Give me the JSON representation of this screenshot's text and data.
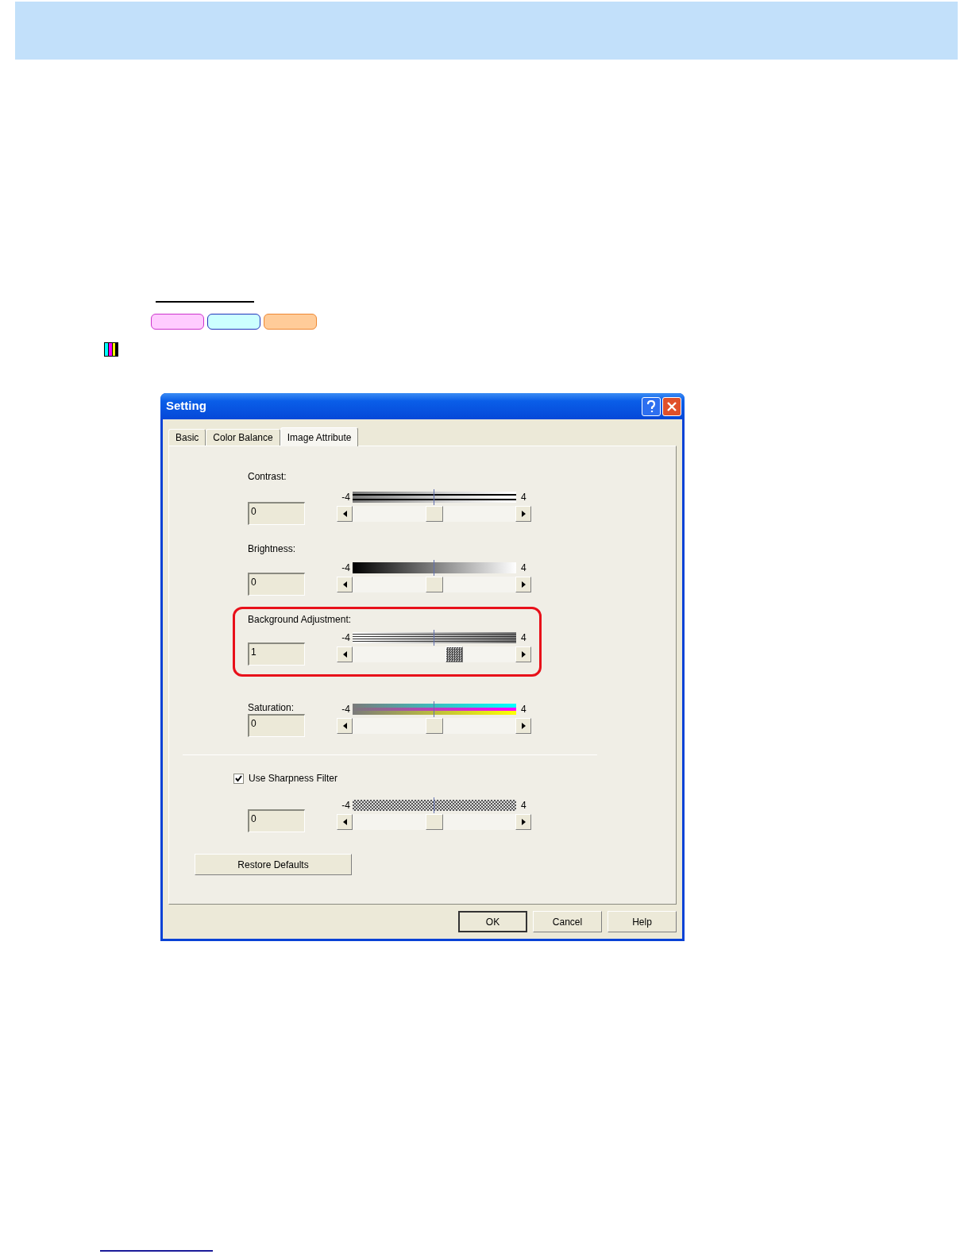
{
  "page": {
    "tags": [
      {
        "color": "#ffccff"
      },
      {
        "color": "#ccffff"
      },
      {
        "color": "#ffcc99"
      }
    ]
  },
  "dialog": {
    "title": "Setting",
    "tabs": [
      {
        "label": "Basic",
        "selected": false
      },
      {
        "label": "Color Balance",
        "selected": false
      },
      {
        "label": "Image Attribute",
        "selected": true
      }
    ],
    "sliders": [
      {
        "kind": "contrast",
        "label": "Contrast:",
        "value": "0",
        "min_label": "-4",
        "max_label": "4",
        "level": 0.5,
        "focused": false,
        "highlighted": false
      },
      {
        "kind": "brightness",
        "label": "Brightness:",
        "value": "0",
        "min_label": "-4",
        "max_label": "4",
        "level": 0.5,
        "focused": false,
        "highlighted": false
      },
      {
        "kind": "background",
        "label": "Background Adjustment:",
        "value": "1",
        "min_label": "-4",
        "max_label": "4",
        "level": 0.625,
        "focused": true,
        "highlighted": true
      },
      {
        "kind": "saturation",
        "label": "Saturation:",
        "value": "0",
        "min_label": "-4",
        "max_label": "4",
        "level": 0.5,
        "focused": false,
        "highlighted": false
      }
    ],
    "sharpness": {
      "checkbox": {
        "label": "Use Sharpness Filter",
        "checked": true
      },
      "slider": {
        "kind": "sharpness",
        "value": "0",
        "min_label": "-4",
        "max_label": "4",
        "level": 0.5,
        "focused": false
      }
    },
    "restore_button": "Restore Defaults",
    "buttons": [
      {
        "label": "OK",
        "default": true
      },
      {
        "label": "Cancel",
        "default": false
      },
      {
        "label": "Help",
        "default": false
      }
    ]
  }
}
